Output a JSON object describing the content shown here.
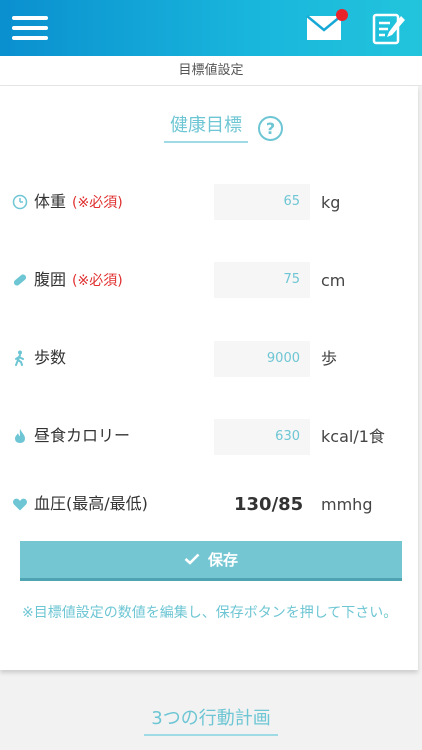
{
  "header": {
    "menu_icon": "hamburger-menu-icon",
    "mail_icon": "mail-icon",
    "edit_icon": "edit-note-icon",
    "notification_color": "#e8232a"
  },
  "subbar": {
    "title": "目標値設定"
  },
  "health": {
    "title": "健康目標",
    "help_label": "?",
    "rows": [
      {
        "icon": "scale-icon",
        "label": "体重",
        "required": "(※必須)",
        "value": "65",
        "unit": "kg"
      },
      {
        "icon": "tape-measure-icon",
        "label": "腹囲",
        "required": "(※必須)",
        "value": "75",
        "unit": "cm"
      },
      {
        "icon": "walking-person-icon",
        "label": "歩数",
        "required": "",
        "value": "9000",
        "unit": "歩"
      },
      {
        "icon": "flame-icon",
        "label": "昼食カロリー",
        "required": "",
        "value": "630",
        "unit": "kcal/1食"
      }
    ],
    "blood_pressure": {
      "icon": "heart-icon",
      "label": "血圧(最高/最低)",
      "value": "130/85",
      "unit": "mmhg"
    }
  },
  "save": {
    "label": "保存",
    "icon": "check-icon"
  },
  "note": "※目標値設定の数値を編集し、保存ボタンを押して下さい。",
  "plan": {
    "title": "3つの行動計画"
  },
  "colors": {
    "accent": "#6ec6d4",
    "button": "#74c6d3",
    "required": "#e03030"
  }
}
